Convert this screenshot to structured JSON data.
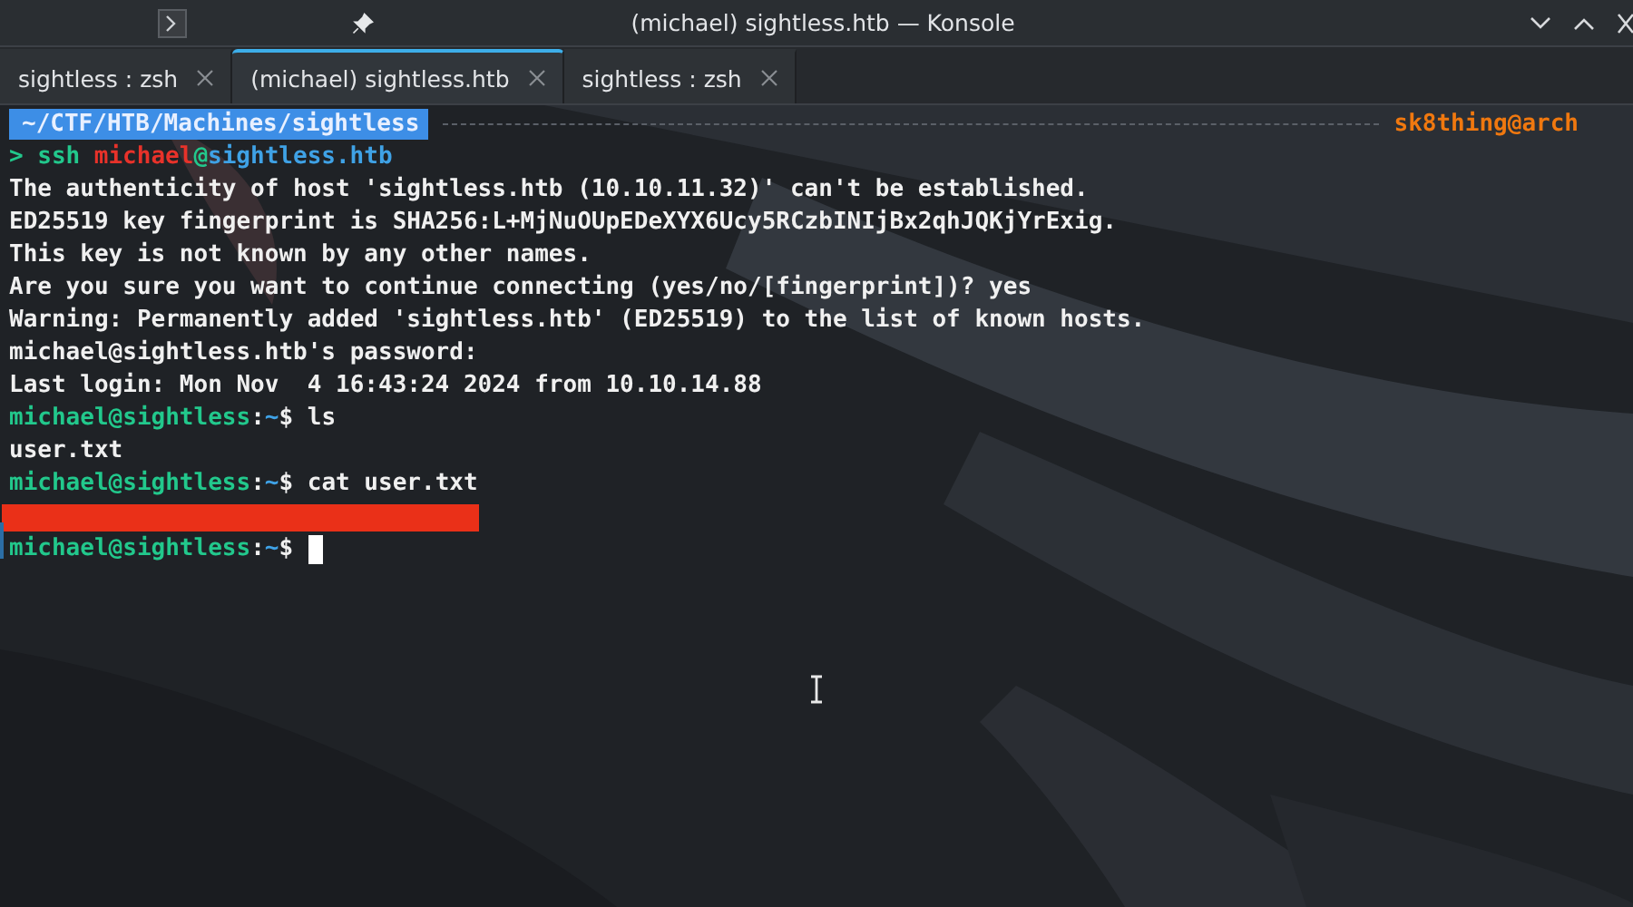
{
  "window": {
    "title": "(michael) sightless.htb — Konsole"
  },
  "tabs": [
    {
      "label": "sightless : zsh",
      "selected": false
    },
    {
      "label": "(michael) sightless.htb",
      "selected": true
    },
    {
      "label": "sightless : zsh",
      "selected": false
    }
  ],
  "prompt_bar": {
    "path": "~/CTF/HTB/Machines/sightless",
    "user_host": "sk8thing@arch"
  },
  "lines": [
    {
      "segments": [
        {
          "kind": "arrow",
          "text": ">"
        },
        {
          "kind": "command",
          "text": "ssh"
        },
        {
          "kind": "user",
          "text": "michael"
        },
        {
          "kind": "at",
          "text": "@"
        },
        {
          "kind": "host",
          "text": "sightless.htb"
        }
      ]
    },
    {
      "segments": [
        {
          "kind": "output",
          "text": "The authenticity of host 'sightless.htb (10.10.11.32)' can't be established."
        }
      ]
    },
    {
      "segments": [
        {
          "kind": "output",
          "text": "ED25519 key fingerprint is SHA256:L+MjNuOUpEDeXYX6Ucy5RCzbINIjBx2qhJQKjYrExig."
        }
      ]
    },
    {
      "segments": [
        {
          "kind": "output",
          "text": "This key is not known by any other names."
        }
      ]
    },
    {
      "segments": [
        {
          "kind": "output",
          "text": "Are you sure you want to continue connecting (yes/no/[fingerprint])? yes"
        }
      ]
    },
    {
      "segments": [
        {
          "kind": "output",
          "text": "Warning: Permanently added 'sightless.htb' (ED25519) to the list of known hosts."
        }
      ]
    },
    {
      "segments": [
        {
          "kind": "output",
          "text": "michael@sightless.htb's password:"
        }
      ]
    },
    {
      "segments": [
        {
          "kind": "output",
          "text": "Last login: Mon Nov  4 16:43:24 2024 from 10.10.14.88"
        }
      ]
    },
    {
      "segments": [
        {
          "kind": "prompt",
          "text": "michael@sightless"
        },
        {
          "kind": "colon",
          "text": ":"
        },
        {
          "kind": "tilde",
          "text": "~"
        },
        {
          "kind": "dollar",
          "text": "$"
        },
        {
          "kind": "output",
          "text": " ls"
        }
      ]
    },
    {
      "segments": [
        {
          "kind": "output",
          "text": "user.txt"
        }
      ]
    },
    {
      "segments": [
        {
          "kind": "prompt",
          "text": "michael@sightless"
        },
        {
          "kind": "colon",
          "text": ":"
        },
        {
          "kind": "tilde",
          "text": "~"
        },
        {
          "kind": "dollar",
          "text": "$"
        },
        {
          "kind": "output",
          "text": " cat user.txt"
        }
      ]
    },
    {
      "segments": [
        {
          "kind": "redacted"
        }
      ]
    },
    {
      "segments": [
        {
          "kind": "prompt",
          "text": "michael@sightless"
        },
        {
          "kind": "colon",
          "text": ":"
        },
        {
          "kind": "tilde",
          "text": "~"
        },
        {
          "kind": "dollar",
          "text": "$"
        },
        {
          "kind": "cursor"
        }
      ]
    }
  ]
}
